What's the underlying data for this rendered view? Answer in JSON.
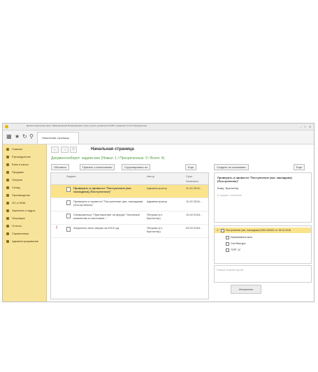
{
  "window": {
    "title": "Демонстрационная база / Иванова Ирина Владимировна / Курс ручного управления КОРП, редакция 3.0 (1С:Предприятие)"
  },
  "toolbar": {
    "home_tab": "Начальная страница"
  },
  "sidebar": {
    "items": [
      {
        "label": "Главное"
      },
      {
        "label": "Руководителю"
      },
      {
        "label": "Банк и касса"
      },
      {
        "label": "Продажи"
      },
      {
        "label": "Покупки"
      },
      {
        "label": "Склад"
      },
      {
        "label": "Производство"
      },
      {
        "label": "ОС и НМА"
      },
      {
        "label": "Зарплата и кадры"
      },
      {
        "label": "Операции"
      },
      {
        "label": "Отчеты"
      },
      {
        "label": "Справочники"
      },
      {
        "label": "Администрирование"
      }
    ]
  },
  "page": {
    "title": "Начальная страница",
    "subtitle": "Документооборот: задачи мне (Новых: 1 / Просроченных: 0 / Всего: 4)"
  },
  "buttons": {
    "refresh": "Обновить",
    "accept": "Принять к исполнению",
    "group": "Сгруппировать по",
    "more": "Еще",
    "create_based": "Создать на основании",
    "more_right": "Еще",
    "execute": "Исполнено"
  },
  "table": {
    "columns": {
      "task": "Задача",
      "author": "Автор",
      "due": "Срок",
      "date_sub": "Записана"
    },
    "rows": [
      {
        "task": "Проверить и провести \"Поступление (акт, накладная) (Поступление)\"",
        "author": "Администратор",
        "date": "11.02.2016..."
      },
      {
        "task": "Проверить и провести \"Поступление (акт, накладная) (Поступление)\"",
        "author": "Администратор",
        "date": "11.02.2016..."
      },
      {
        "task": "Ознакомиться \"Приглашение на форум \"Основные изменения в налоговом...\"",
        "author": "Петрова (гл. бухгалтер)",
        "date": "10.02.2016..."
      },
      {
        "task": "Запросить акты сверки за 2015 год",
        "author": "Петрова (гл. бухгалтер)",
        "date": "09.02.2016..."
      }
    ]
  },
  "details": {
    "heading": "Проверить и провести \"Поступление (акт, накладная) (Поступление)\"",
    "to": "Кому: Бухгалтер",
    "placeholder": "К задаче описание"
  },
  "tree": {
    "root": "Поступление (акт, накладная) 0000-000001 от 26.01.2016",
    "items": [
      "Нормативные акты",
      "СчетФактура",
      "ТОРГ-12"
    ]
  },
  "comment_placeholder": "Новый комментарий"
}
